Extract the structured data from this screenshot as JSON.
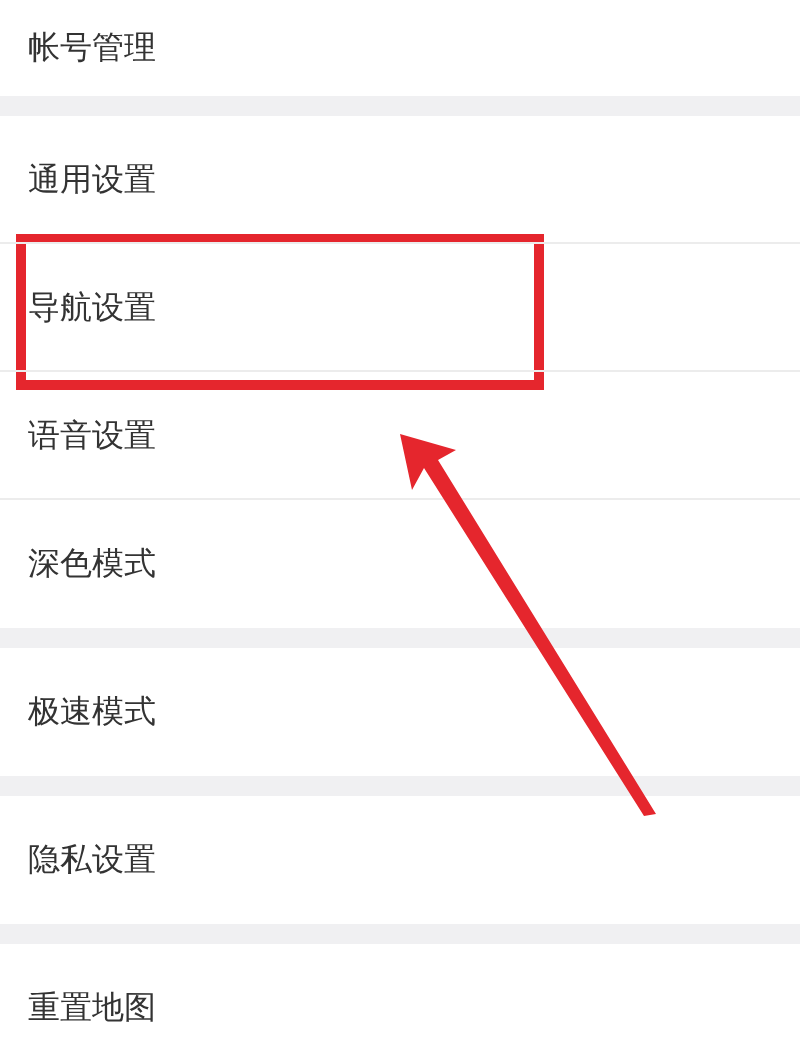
{
  "groups": [
    {
      "items": [
        {
          "label": "帐号管理",
          "highlighted": false
        }
      ]
    },
    {
      "items": [
        {
          "label": "通用设置",
          "highlighted": false
        },
        {
          "label": "导航设置",
          "highlighted": true
        },
        {
          "label": "语音设置",
          "highlighted": false
        },
        {
          "label": "深色模式",
          "highlighted": false
        }
      ]
    },
    {
      "items": [
        {
          "label": "极速模式",
          "highlighted": false
        }
      ]
    },
    {
      "items": [
        {
          "label": "隐私设置",
          "highlighted": false
        }
      ]
    },
    {
      "items": [
        {
          "label": "重置地图",
          "highlighted": false
        }
      ]
    }
  ]
}
